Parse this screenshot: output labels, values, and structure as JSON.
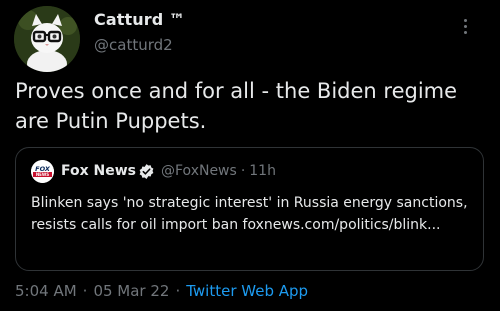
{
  "author": {
    "display_name": "Catturd ™",
    "handle": "@catturd2",
    "avatar_icon": "cat-with-glasses-avatar"
  },
  "tweet": {
    "text": "Proves once and for all - the Biden regime are Putin Puppets."
  },
  "quoted_tweet": {
    "logo_icon": "fox-news-logo",
    "display_name": "Fox News",
    "verified": true,
    "handle": "@FoxNews",
    "separator": "·",
    "age": "11h",
    "text": "Blinken says 'no strategic interest' in Russia energy sanctions, resists calls for oil import ban foxnews.com/politics/blink..."
  },
  "footer": {
    "time": "5:04 AM",
    "separator": "·",
    "date": "05 Mar 22",
    "separator2": "·",
    "source": "Twitter Web App"
  },
  "colors": {
    "background": "#000000",
    "text": "#e7e9ea",
    "muted": "#71767b",
    "link": "#1d9bf0",
    "border": "#2f3336",
    "verified_badge": "#e7e9ea"
  }
}
